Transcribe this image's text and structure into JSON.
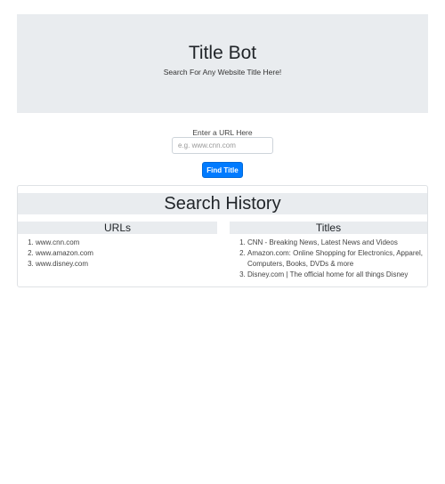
{
  "header": {
    "title": "Title Bot",
    "subtitle": "Search For Any Website Title Here!"
  },
  "form": {
    "label": "Enter a URL Here",
    "placeholder": "e.g. www.cnn.com",
    "value": "",
    "button": "Find Title"
  },
  "history": {
    "title": "Search History",
    "urls_header": "URLs",
    "titles_header": "Titles",
    "urls": [
      "www.cnn.com",
      "www.amazon.com",
      "www.disney.com"
    ],
    "titles": [
      "CNN - Breaking News, Latest News and Videos",
      "Amazon.com: Online Shopping for Electronics, Apparel, Computers, Books, DVDs & more",
      "Disney.com | The official home for all things Disney"
    ]
  }
}
